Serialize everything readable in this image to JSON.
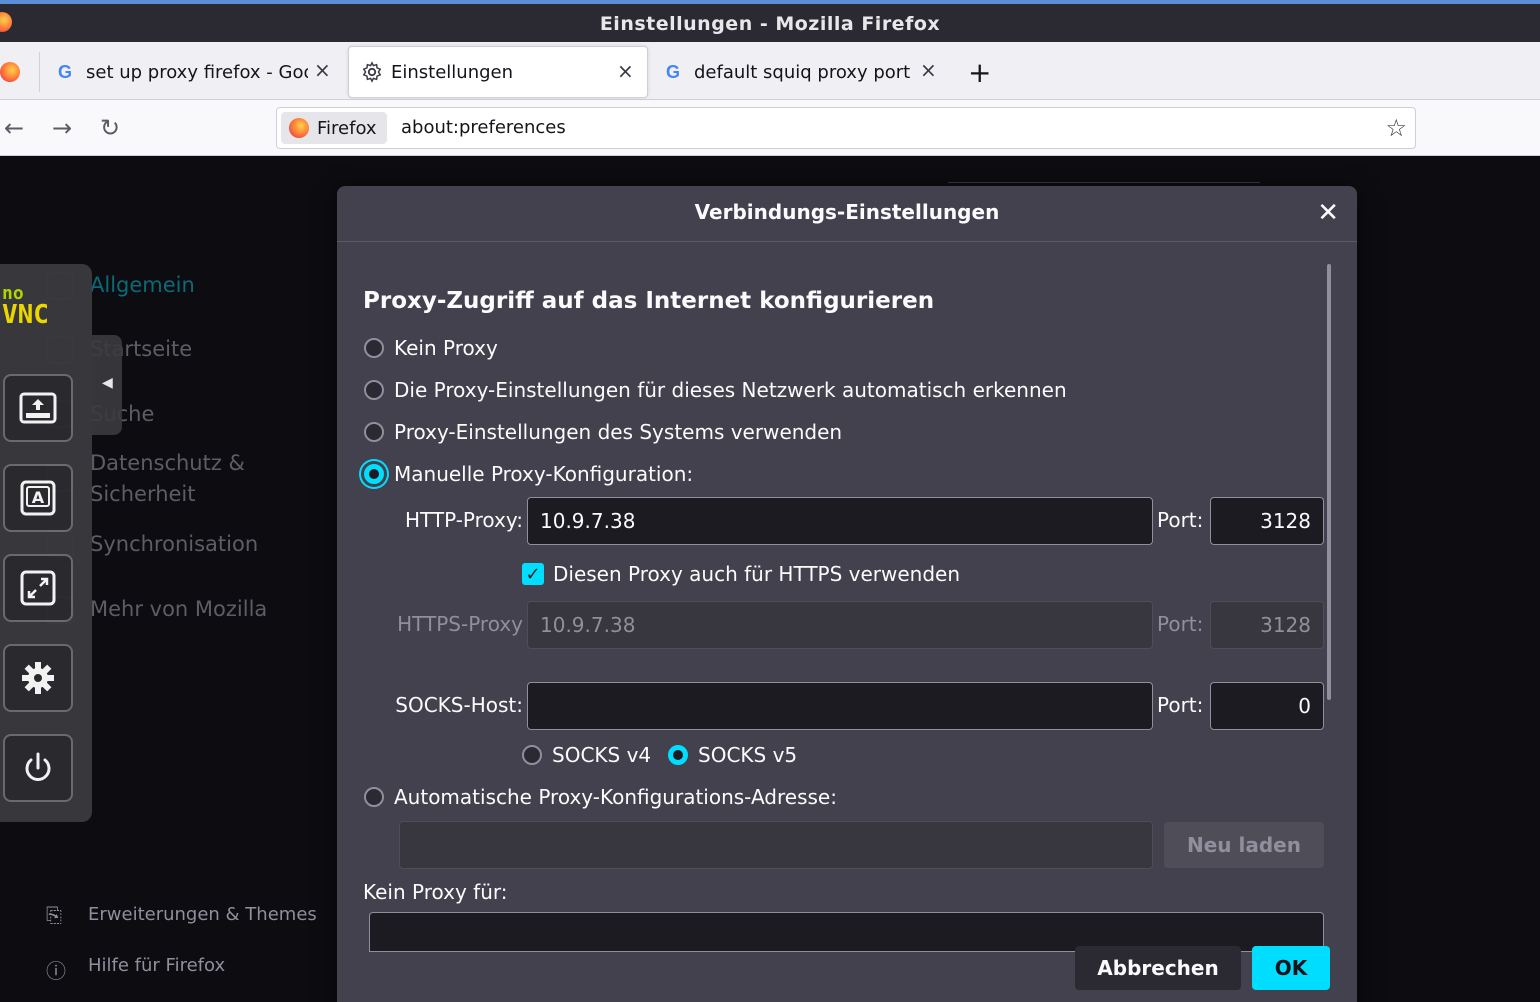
{
  "window": {
    "title": "Einstellungen - Mozilla Firefox"
  },
  "tabs": [
    {
      "label": "set up proxy firefox - Goo",
      "icon": "google-icon"
    },
    {
      "label": "Einstellungen",
      "icon": "gear-icon"
    },
    {
      "label": "default squiq proxy port -",
      "icon": "google-icon"
    }
  ],
  "newtab": "+",
  "urlbar": {
    "identity": "Firefox",
    "url": "about:preferences"
  },
  "sidebar": {
    "categories": [
      "Allgemein",
      "Startseite",
      "Suche",
      "Datenschutz &",
      "Sicherheit",
      "Synchronisation",
      "Mehr von Mozilla"
    ],
    "footer": [
      "Erweiterungen & Themes",
      "Hilfe für Firefox"
    ]
  },
  "novnc": {
    "logo_top": "no",
    "logo_bottom": "VNC"
  },
  "dialog": {
    "title": "Verbindungs-Einstellungen",
    "heading": "Proxy-Zugriff auf das Internet konfigurieren",
    "options": {
      "none": "Kein Proxy",
      "auto_detect": "Die Proxy-Einstellungen für dieses Netzwerk automatisch erkennen",
      "system": "Proxy-Einstellungen des Systems verwenden",
      "manual": "Manuelle Proxy-Konfiguration:",
      "pac": "Automatische Proxy-Konfigurations-Adresse:"
    },
    "selected": "manual",
    "http": {
      "label": "HTTP-Proxy:",
      "value": "10.9.7.38",
      "port_label": "Port:",
      "port": "3128"
    },
    "https_same": {
      "label": "Diesen Proxy auch für HTTPS verwenden",
      "checked": true
    },
    "https": {
      "label": "HTTPS-Proxy",
      "value": "10.9.7.38",
      "port_label": "Port:",
      "port": "3128"
    },
    "socks": {
      "label": "SOCKS-Host:",
      "value": "",
      "port_label": "Port:",
      "port": "0",
      "v4": "SOCKS v4",
      "v5": "SOCKS v5",
      "version": "v5"
    },
    "reload_button": "Neu laden",
    "no_proxy_label": "Kein Proxy für:",
    "cancel_button": "Abbrechen",
    "ok_button": "OK"
  },
  "colors": {
    "accent": "#00ddff",
    "dialog_bg": "#42414d",
    "page_bg": "#0d0c10"
  }
}
